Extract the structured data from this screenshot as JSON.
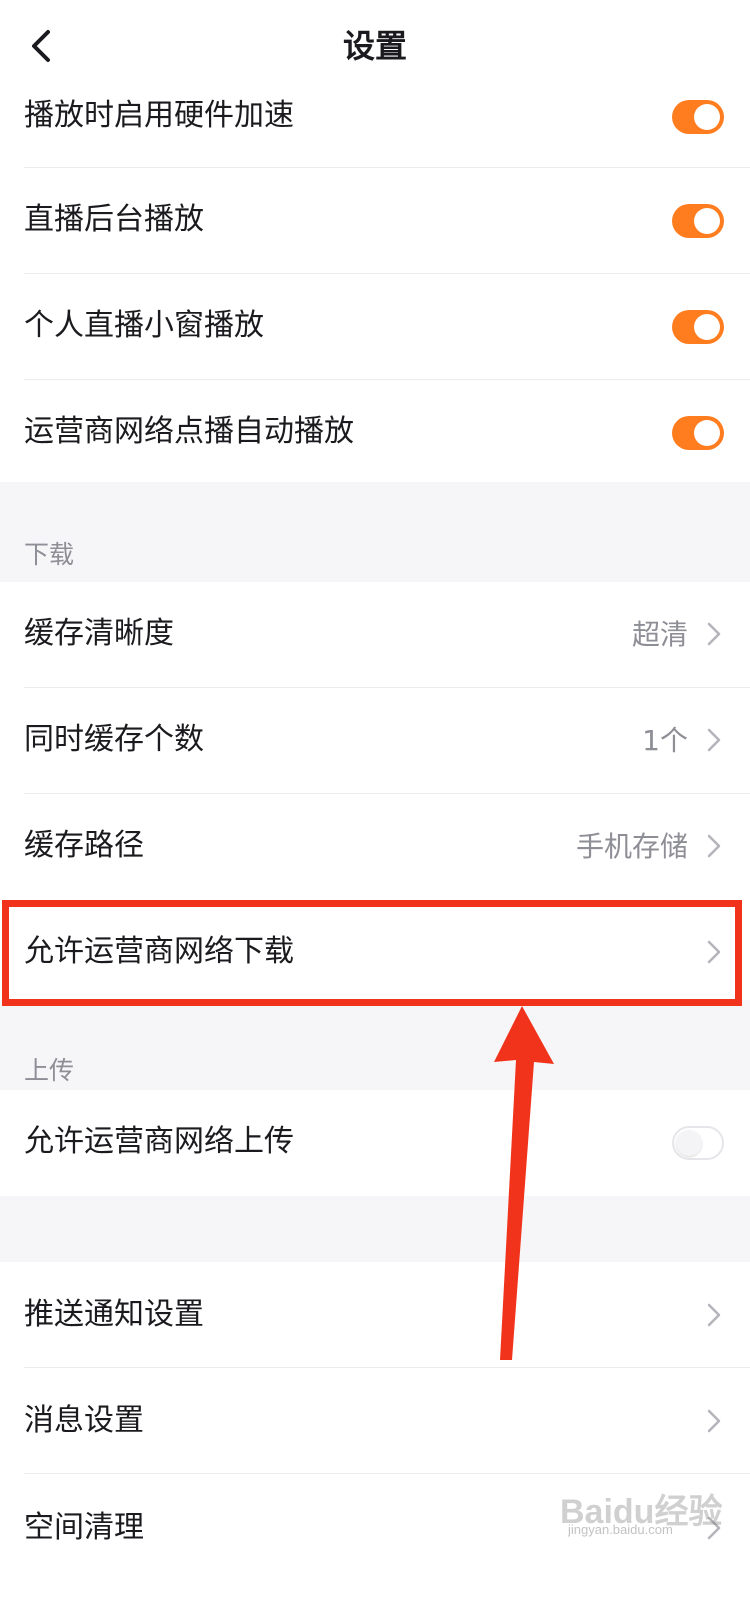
{
  "header": {
    "title": "设置"
  },
  "playback": {
    "items": [
      {
        "label": "播放时启用硬件加速",
        "toggle": "on"
      },
      {
        "label": "直播后台播放",
        "toggle": "on"
      },
      {
        "label": "个人直播小窗播放",
        "toggle": "on"
      },
      {
        "label": "运营商网络点播自动播放",
        "toggle": "on"
      }
    ]
  },
  "download": {
    "section_title": "下载",
    "items": [
      {
        "label": "缓存清晰度",
        "value": "超清"
      },
      {
        "label": "同时缓存个数",
        "value": "1个"
      },
      {
        "label": "缓存路径",
        "value": "手机存储"
      },
      {
        "label": "允许运营商网络下载",
        "value": ""
      }
    ]
  },
  "upload": {
    "section_title": "上传",
    "items": [
      {
        "label": "允许运营商网络上传",
        "toggle": "off"
      }
    ]
  },
  "other": {
    "items": [
      {
        "label": "推送通知设置"
      },
      {
        "label": "消息设置"
      },
      {
        "label": "空间清理"
      }
    ]
  },
  "watermark": {
    "brand": "Baidu经验",
    "url": "jingyan.baidu.com"
  },
  "colors": {
    "accent": "#ff7c1f",
    "highlight": "#f2331c",
    "section_bg": "#f6f6f9"
  }
}
